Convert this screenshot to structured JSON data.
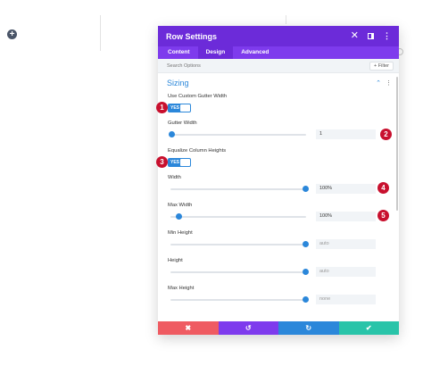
{
  "modal": {
    "title": "Row Settings",
    "icons": [
      "close-icon",
      "columns-icon",
      "kebab-icon"
    ]
  },
  "tabs": [
    {
      "label": "Content",
      "active": false
    },
    {
      "label": "Design",
      "active": true
    },
    {
      "label": "Advanced",
      "active": false
    }
  ],
  "search": {
    "placeholder": "Search Options",
    "filter_label": "+ Filter"
  },
  "section": {
    "title": "Sizing"
  },
  "settings": {
    "gutter_toggle": {
      "label": "Use Custom Gutter Width",
      "state": "YES",
      "badge": "1"
    },
    "gutter_width": {
      "label": "Gutter Width",
      "value": "1",
      "slider_fraction": 0.0,
      "badge": "2"
    },
    "equalize_toggle": {
      "label": "Equalize Column Heights",
      "state": "YES",
      "badge": "3"
    },
    "width": {
      "label": "Width",
      "value": "100%",
      "slider_fraction": 1.0,
      "badge": "4"
    },
    "max_width": {
      "label": "Max Width",
      "value": "100%",
      "slider_fraction": 0.05,
      "badge": "5"
    },
    "min_height": {
      "label": "Min Height",
      "placeholder": "auto",
      "slider_fraction": 1.0
    },
    "height": {
      "label": "Height",
      "placeholder": "auto",
      "slider_fraction": 1.0
    },
    "max_height": {
      "label": "Max Height",
      "placeholder": "none",
      "slider_fraction": 1.0
    }
  },
  "footer": {
    "cancel_glyph": "✖",
    "undo_glyph": "↺",
    "redo_glyph": "↻",
    "save_glyph": "✔"
  },
  "colors": {
    "header": "#6c2bd9",
    "tabs": "#7e3bed",
    "accent": "#2b87da",
    "badge": "#c8102e",
    "cancel": "#ef5b62",
    "save": "#29c4a9"
  }
}
